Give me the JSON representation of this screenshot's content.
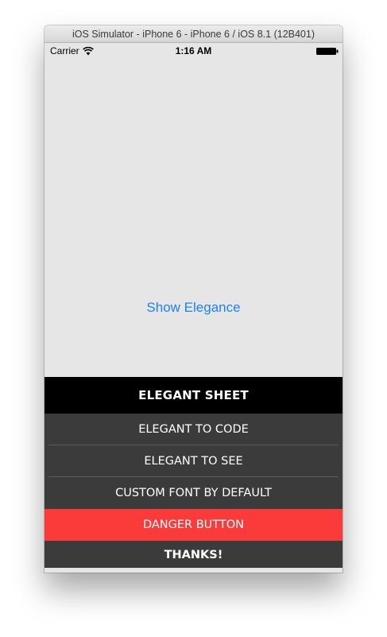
{
  "window": {
    "title": "iOS Simulator - iPhone 6 - iPhone 6 / iOS 8.1 (12B401)"
  },
  "status_bar": {
    "carrier": "Carrier",
    "time": "1:16 AM",
    "icons": [
      "wifi-icon",
      "battery-icon"
    ]
  },
  "main": {
    "show_button_label": "Show Elegance",
    "link_color": "#1a82fb"
  },
  "action_sheet": {
    "title": "ELEGANT SHEET",
    "buttons": [
      {
        "label": "ELEGANT TO CODE"
      },
      {
        "label": "ELEGANT TO SEE"
      },
      {
        "label": "CUSTOM FONT BY DEFAULT"
      },
      {
        "label": "DANGER BUTTON",
        "style": "destructive",
        "color": "#fb3a3a"
      }
    ],
    "cancel_label": "THANKS!"
  }
}
